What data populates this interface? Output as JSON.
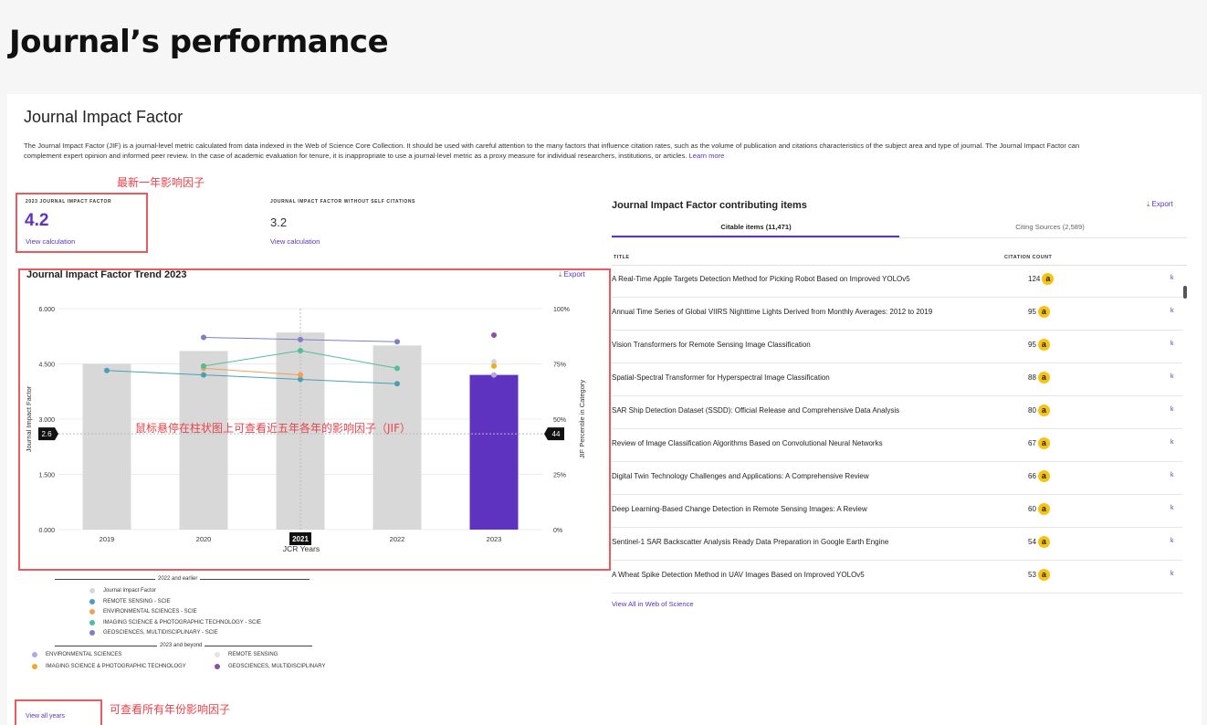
{
  "page_title": "Journal’s performance",
  "section_title": "Journal Impact Factor",
  "description": "The Journal Impact Factor (JIF) is a journal-level metric calculated from data indexed in the Web of Science Core Collection. It should be used with careful attention to the many factors that influence citation rates, such as the volume of publication and citations characteristics of the subject area and type of journal. The Journal Impact Factor can complement expert opinion and informed peer review. In the case of academic evaluation for tenure, it is inappropriate to use a journal-level metric as a proxy measure for individual researchers, institutions, or articles.",
  "learn_more": "Learn more",
  "annotations": {
    "latest_year": "最新一年影响因子",
    "hover_tip": "鼠标悬停在柱状图上可查看近五年各年的影响因子（JIF）",
    "all_years": "可查看所有年份影响因子"
  },
  "jif": {
    "label": "2023 JOURNAL IMPACT FACTOR",
    "value": "4.2",
    "view_calc": "View calculation",
    "self_label": "JOURNAL IMPACT FACTOR WITHOUT SELF CITATIONS",
    "self_value": "3.2",
    "self_view_calc": "View calculation"
  },
  "chart_title": "Journal Impact Factor Trend 2023",
  "export_label": "Export",
  "export_icon": "download-icon",
  "chart_data": {
    "type": "bar",
    "categories": [
      "2019",
      "2020",
      "2021",
      "2022",
      "2023"
    ],
    "values": [
      4.5,
      4.85,
      5.35,
      5.0,
      4.2
    ],
    "highlight_color": "#5e33bf",
    "bar_color": "#d8d8d8",
    "xlabel": "JCR Years",
    "ylabel": "Journal Impact Factor",
    "y2label": "JIF Percentile in Category",
    "ylim": [
      0,
      6
    ],
    "yticks": [
      "0.000",
      "1.500",
      "3.000",
      "4.500",
      "6.000"
    ],
    "y2lim": [
      0,
      100
    ],
    "y2ticks": [
      "0%",
      "25%",
      "50%",
      "75%",
      "100%"
    ],
    "hover": {
      "category": "2021",
      "y_label": "2.6",
      "y2_label": "44"
    },
    "series": [
      {
        "name": "REMOTE SENSING - SCIE",
        "color": "#4a9fb5",
        "x": [
          "2019",
          "2020",
          "2021",
          "2022"
        ],
        "values": [
          72,
          70,
          68,
          66
        ]
      },
      {
        "name": "ENVIRONMENTAL SCIENCES - SCIE",
        "color": "#f0a058",
        "x": [
          "2020",
          "2021"
        ],
        "values": [
          73,
          70
        ]
      },
      {
        "name": "IMAGING SCIENCE & PHOTOGRAPHIC TECHNOLOGY - SCIE",
        "color": "#4fbf9a",
        "x": [
          "2020",
          "2021",
          "2022"
        ],
        "values": [
          74,
          81,
          73
        ]
      },
      {
        "name": "GEOSCIENCES, MULTIDISCIPLINARY - SCIE",
        "color": "#7d7fc4",
        "x": [
          "2020",
          "2021",
          "2022"
        ],
        "values": [
          87,
          86,
          85
        ]
      },
      {
        "name": "ENVIRONMENTAL SCIENCES",
        "color": "#b3a8e0",
        "x": [
          "2023"
        ],
        "values": [
          70
        ]
      },
      {
        "name": "REMOTE SENSING",
        "color": "#d6d6d6",
        "x": [
          "2023"
        ],
        "values": [
          76
        ]
      },
      {
        "name": "IMAGING SCIENCE & PHOTOGRAPHIC TECHNOLOGY",
        "color": "#e8b020",
        "x": [
          "2023"
        ],
        "values": [
          74
        ]
      },
      {
        "name": "GEOSCIENCES, MULTIDISCIPLINARY",
        "color": "#8a4fa8",
        "x": [
          "2023"
        ],
        "values": [
          88
        ]
      }
    ]
  },
  "legend": {
    "group1_title": "2022 and earlier",
    "group1_items": [
      {
        "label": "Journal Impact Factor",
        "color": "#d8d8d8"
      },
      {
        "label": "REMOTE SENSING - SCIE",
        "color": "#4a9fb5"
      },
      {
        "label": "ENVIRONMENTAL SCIENCES - SCIE",
        "color": "#f0a058"
      },
      {
        "label": "IMAGING SCIENCE & PHOTOGRAPHIC TECHNOLOGY - SCIE",
        "color": "#4fbf9a"
      },
      {
        "label": "GEOSCIENCES, MULTIDISCIPLINARY - SCIE",
        "color": "#7d7fc4"
      }
    ],
    "group2_title": "2023 and beyond",
    "group2_items": [
      {
        "label": "ENVIRONMENTAL SCIENCES",
        "color": "#b3a8e0"
      },
      {
        "label": "REMOTE SENSING",
        "color": "#e4e4e4"
      },
      {
        "label": "IMAGING SCIENCE & PHOTOGRAPHIC TECHNOLOGY",
        "color": "#e8b020"
      },
      {
        "label": "GEOSCIENCES, MULTIDISCIPLINARY",
        "color": "#8a4fa8"
      }
    ]
  },
  "view_all_years": "View all years",
  "contributing": {
    "title": "Journal Impact Factor contributing items",
    "export_label": "Export",
    "tab_citable": "Citable items (11,471)",
    "tab_citing": "Citing Sources (2,589)",
    "col_title": "TITLE",
    "col_count": "CITATION COUNT",
    "rows": [
      {
        "title": "A Real-Time Apple Targets Detection Method for Picking Robot Based on Improved YOLOv5",
        "count": "124",
        "badge": "a",
        "k": "k"
      },
      {
        "title": "Annual Time Series of Global VIIRS Nighttime Lights Derived from Monthly Averages: 2012 to 2019",
        "count": "95",
        "badge": "a",
        "k": "k"
      },
      {
        "title": "Vision Transformers for Remote Sensing Image Classification",
        "count": "95",
        "badge": "a",
        "k": "k"
      },
      {
        "title": "Spatial-Spectral Transformer for Hyperspectral Image Classification",
        "count": "88",
        "badge": "a",
        "k": "k"
      },
      {
        "title": "SAR Ship Detection Dataset (SSDD): Official Release and Comprehensive Data Analysis",
        "count": "80",
        "badge": "a",
        "k": "k"
      },
      {
        "title": "Review of Image Classification Algorithms Based on Convolutional Neural Networks",
        "count": "67",
        "badge": "a",
        "k": "k"
      },
      {
        "title": "Digital Twin Technology Challenges and Applications: A Comprehensive Review",
        "count": "66",
        "badge": "a",
        "k": "k"
      },
      {
        "title": "Deep Learning-Based Change Detection in Remote Sensing Images: A Review",
        "count": "60",
        "badge": "a",
        "k": "k"
      },
      {
        "title": "Sentinel-1 SAR Backscatter Analysis Ready Data Preparation in Google Earth Engine",
        "count": "54",
        "badge": "a",
        "k": "k"
      },
      {
        "title": "A Wheat Spike Detection Method in UAV Images Based on Improved YOLOv5",
        "count": "53",
        "badge": "a",
        "k": "k"
      }
    ],
    "view_all": "View All in Web of Science"
  }
}
